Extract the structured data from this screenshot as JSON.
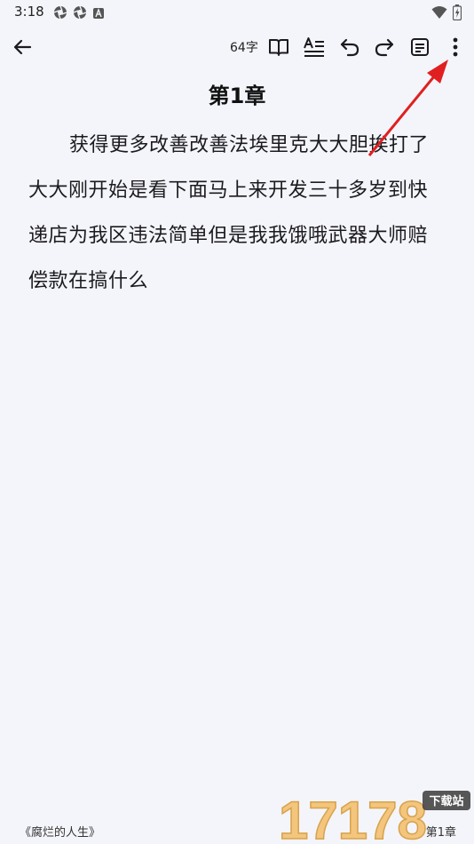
{
  "status_bar": {
    "time": "3:18",
    "left_icons": [
      "aperture-icon",
      "aperture-icon",
      "translate-a-icon"
    ],
    "right_icons": [
      "wifi-icon",
      "battery-charging-icon"
    ]
  },
  "toolbar": {
    "word_count": "64字",
    "buttons": [
      "back-arrow-icon",
      "book-icon",
      "text-format-icon",
      "undo-icon",
      "redo-icon",
      "note-icon",
      "more-vert-icon"
    ]
  },
  "content": {
    "chapter_title": "第1章",
    "body": "获得更多改善改善法埃里克大大胆挨打了大大刚开始是看下面马上来开发三十多岁到快递店为我区违法简单但是我我饿哦武器大师赔偿款在搞什么"
  },
  "footer": {
    "book_title": "《腐烂的人生》",
    "page_label": "第1章"
  },
  "watermark": {
    "number": "17178",
    "badge": "下载站"
  },
  "annotation": {
    "arrow_color": "#e02020",
    "accent": "#1b1b1f"
  }
}
